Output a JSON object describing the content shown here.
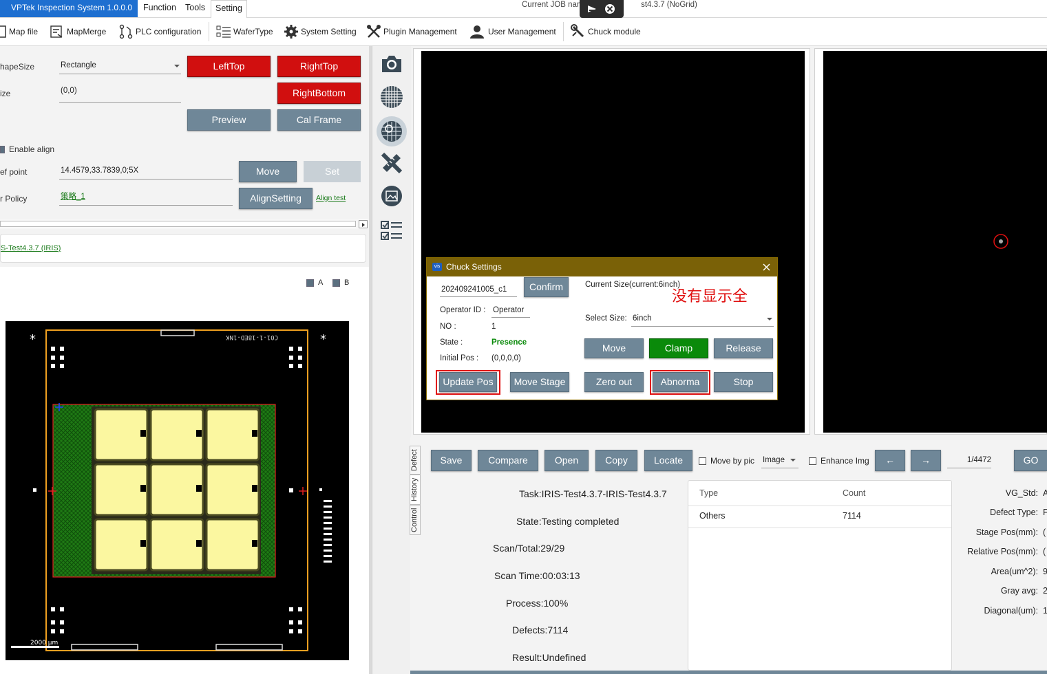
{
  "app": {
    "title": "VPTek Inspection System 1.0.0.0",
    "job_name_visible": "Current JOB name",
    "job_name_tail": "st4.3.7 (NoGrid)"
  },
  "menu": [
    "Function",
    "Tools",
    "Setting"
  ],
  "toolbar": [
    {
      "label": "Map file",
      "icon": "map-file-icon"
    },
    {
      "label": "MapMerge",
      "icon": "map-merge-icon"
    },
    {
      "label": "PLC configuration",
      "icon": "plc-icon"
    },
    {
      "label": "WaferType",
      "icon": "list-icon"
    },
    {
      "label": "System Setting",
      "icon": "gear-icon"
    },
    {
      "label": "Plugin Management",
      "icon": "tools-icon"
    },
    {
      "label": "User Management",
      "icon": "user-icon"
    },
    {
      "label": "Chuck module",
      "icon": "wrench-icon"
    }
  ],
  "left": {
    "shape_size_label": "hapeSize",
    "shape_size_value": "Rectangle",
    "size_label": "ize",
    "size_value": "(0,0)",
    "btn_left_top": "LeftTop",
    "btn_right_top": "RightTop",
    "btn_right_bottom": "RightBottom",
    "btn_preview": "Preview",
    "btn_cal_frame": "Cal Frame",
    "enable_align": "Enable align",
    "ref_point_label": "ef point",
    "ref_point_value": "14.4579,33.7839,0;5X",
    "btn_move": "Move",
    "btn_set": "Set",
    "policy_label": "r Policy",
    "policy_value": "策略_1",
    "btn_align_setting": "AlignSetting",
    "align_test": "Align test",
    "job_link": "S-Test4.3.7 (IRIS)",
    "check_a": "A",
    "check_b": "B",
    "map_label_top": "C01-1-18ED-1NK",
    "scale_label": "2000 μm"
  },
  "chuck": {
    "title": "Chuck Settings",
    "batch_value": "202409241005_c1",
    "btn_confirm": "Confirm",
    "current_size": "Current Size(current:6inch)",
    "annotation": "没有显示全",
    "operator_label": "Operator ID :",
    "operator_value": "Operator",
    "no_label": "NO :",
    "no_value": "1",
    "state_label": "State :",
    "state_value": "Presence",
    "initial_label": "Initial Pos :",
    "initial_value": "(0,0,0,0)",
    "select_size_label": "Select Size:",
    "select_size_value": "6inch",
    "btn_move": "Move",
    "btn_clamp": "Clamp",
    "btn_release": "Release",
    "btn_update_pos": "Update Pos",
    "btn_move_stage": "Move Stage",
    "btn_zero_out": "Zero out",
    "btn_abnormal": "Abnorma",
    "btn_stop": "Stop",
    "colors": {
      "title_bar": "#7a6107",
      "clamp": "#0a8a0a",
      "presence": "#0a8a0a"
    }
  },
  "bottom": {
    "tabs": [
      "Defect",
      "History",
      "Control"
    ],
    "btn_save": "Save",
    "btn_compare": "Compare",
    "btn_open": "Open",
    "btn_copy": "Copy",
    "btn_locate": "Locate",
    "move_by_pic": "Move by pic",
    "image_select": "Image",
    "enhance_img": "Enhance Img",
    "btn_prev": "←",
    "btn_next": "→",
    "page_value": "1/4472",
    "btn_go": "GO",
    "task": "Task:IRIS-Test4.3.7-IRIS-Test4.3.7",
    "state": "State:Testing completed",
    "scan_total": "Scan/Total:29/29",
    "scan_time": "Scan Time:00:03:13",
    "process": "Process:100%",
    "defects": "Defects:7114",
    "result": "Result:Undefined",
    "table_headers": [
      "Type",
      "Count"
    ],
    "table_rows": [
      [
        "Others",
        "7114"
      ]
    ],
    "info_labels": [
      "VG_Std:",
      "Defect Type:",
      "Stage Pos(mm):",
      "Relative Pos(mm):",
      "Area(um^2):",
      "Gray avg:",
      "Diagonal(um):"
    ],
    "info_values": [
      "A",
      "F",
      "(",
      "(",
      "9",
      "2",
      "1"
    ]
  }
}
